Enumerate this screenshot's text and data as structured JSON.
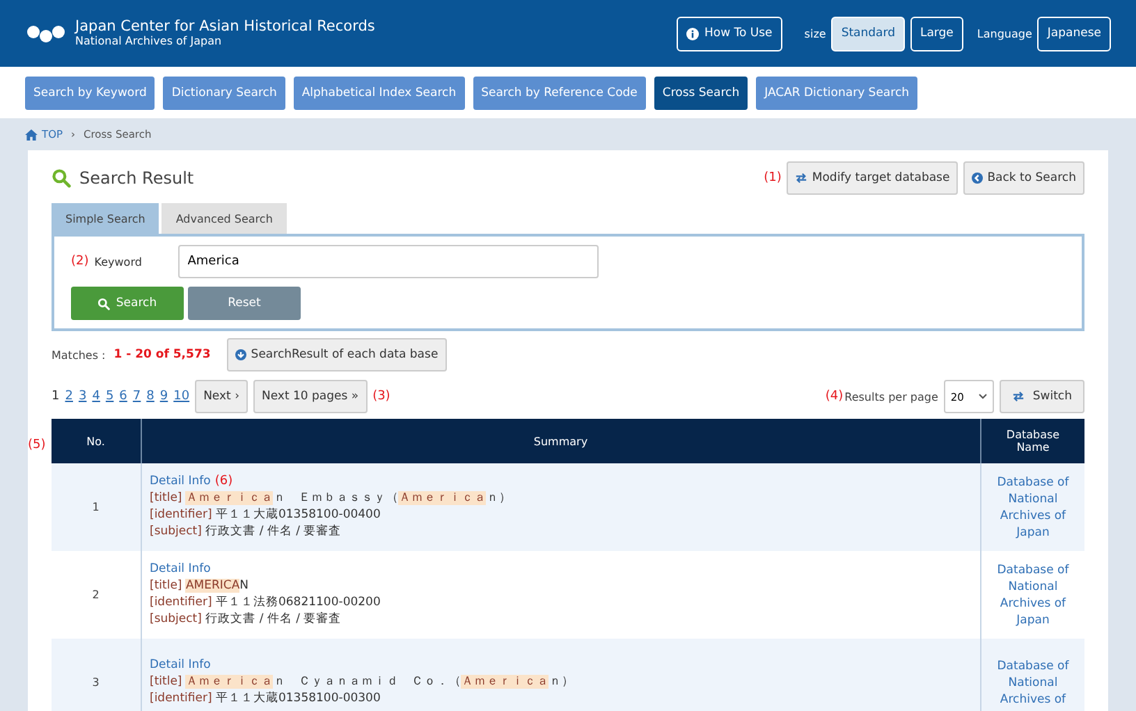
{
  "header": {
    "logo_line1": "Japan Center for Asian Historical Records",
    "logo_line2": "National Archives of Japan",
    "how_to_use": "How To Use",
    "size_label": "size",
    "sizes": [
      {
        "label": "Standard",
        "selected": true
      },
      {
        "label": "Large",
        "selected": false
      }
    ],
    "language_label": "Language",
    "language": "Japanese"
  },
  "nav": [
    {
      "label": "Search by Keyword",
      "selected": false
    },
    {
      "label": "Dictionary Search",
      "selected": false
    },
    {
      "label": "Alphabetical Index Search",
      "selected": false
    },
    {
      "label": "Search by Reference Code",
      "selected": false
    },
    {
      "label": "Cross Search",
      "selected": true
    },
    {
      "label": "JACAR Dictionary Search",
      "selected": false
    }
  ],
  "breadcrumb": {
    "home": "TOP",
    "separator": "›",
    "current": "Cross Search"
  },
  "title": "Search Result",
  "marker_1": "(1)",
  "modify_button": "Modify target database",
  "back_button": "Back to Search",
  "search_tabs": [
    {
      "label": "Simple Search",
      "selected": true
    },
    {
      "label": "Advanced Search",
      "selected": false
    }
  ],
  "marker_2": "(2)",
  "keyword_label": "Keyword",
  "keyword_value": "America",
  "search_button": "Search",
  "reset_button": "Reset",
  "matches_label": "Matches :",
  "matches_value": "1 - 20 of 5,573",
  "each_db_button": "SearchResult of each data base",
  "pages": [
    {
      "label": "1",
      "selected": true
    },
    {
      "label": "2",
      "selected": false
    },
    {
      "label": "3",
      "selected": false
    },
    {
      "label": "4",
      "selected": false
    },
    {
      "label": "5",
      "selected": false
    },
    {
      "label": "6",
      "selected": false
    },
    {
      "label": "7",
      "selected": false
    },
    {
      "label": "8",
      "selected": false
    },
    {
      "label": "9",
      "selected": false
    },
    {
      "label": "10",
      "selected": false
    }
  ],
  "next_button": "Next ›",
  "next10_button": "Next 10 pages »",
  "marker_3": "(3)",
  "marker_4": "(4)",
  "per_page_label": "Results per page",
  "per_page_value": "20",
  "switch_button": "Switch",
  "table": {
    "marker_5": "(5)",
    "columns": [
      "No.",
      "Summary",
      "Database Name"
    ],
    "rows": [
      {
        "no": "1",
        "detail": "Detail Info",
        "marker": "(6)",
        "title_label": "[title]",
        "identifier_label": "[identifier]",
        "subject_label": "[subject]",
        "title": [
          {
            "text": "Ａｍｅｒｉｃａ",
            "highlight": true
          },
          {
            "text": "ｎ　Ｅｍｂａｓｓｙ（",
            "highlight": false
          },
          {
            "text": "Ａｍｅｒｉｃａ",
            "highlight": true
          },
          {
            "text": "ｎ）",
            "highlight": false
          }
        ],
        "identifier": "平１１大蔵01358100-00400",
        "subject": "行政文書 /  件名 /  要審査",
        "database": "Database of National Archives of Japan"
      },
      {
        "no": "2",
        "detail": "Detail Info",
        "title_label": "[title]",
        "identifier_label": "[identifier]",
        "subject_label": "[subject]",
        "title": [
          {
            "text": "AMERICA",
            "highlight": true
          },
          {
            "text": "N",
            "highlight": false
          }
        ],
        "identifier": "平１１法務06821100-00200",
        "subject": "行政文書 /  件名 /  要審査",
        "database": "Database of National Archives of Japan"
      },
      {
        "no": "3",
        "detail": "Detail Info",
        "title_label": "[title]",
        "identifier_label": "[identifier]",
        "title": [
          {
            "text": "Ａｍｅｒｉｃａ",
            "highlight": true
          },
          {
            "text": "ｎ　Ｃｙａｎａｍｉｄ　Ｃｏ．（",
            "highlight": false
          },
          {
            "text": "Ａｍｅｒｉｃａ",
            "highlight": true
          },
          {
            "text": "ｎ）",
            "highlight": false
          }
        ],
        "identifier": "平１１大蔵01358100-00300",
        "database": "Database of National Archives of"
      }
    ]
  }
}
